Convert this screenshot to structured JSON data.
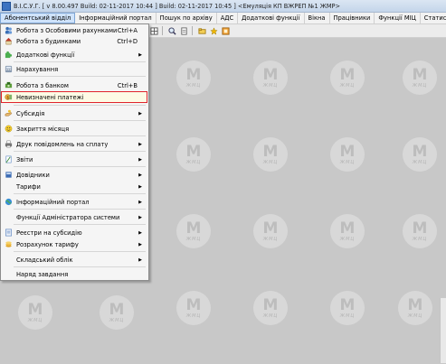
{
  "title_bar": {
    "text": "В.І.С.У.Г. [ v 8.00.497 Build: 02-11-2017 10:44 ]   Build: 02-11-2017 10:45 ] <Емуляція КП ВЖРЕП №1 ЖМР>"
  },
  "menubar": {
    "items": [
      {
        "label": "Абонентський відділ",
        "active": true
      },
      {
        "label": "Інформаційний портал"
      },
      {
        "label": "Пошук по архіву"
      },
      {
        "label": "АДС"
      },
      {
        "label": "Додаткові функції"
      },
      {
        "label": "Вікна"
      },
      {
        "label": "Працівники"
      },
      {
        "label": "Функції МІЦ"
      },
      {
        "label": "Статистика"
      }
    ]
  },
  "toolbar": {
    "icons": [
      "grid-icon",
      "magnifier-icon",
      "document-icon",
      "folder-icon",
      "star-icon",
      "palette-icon"
    ]
  },
  "dropdown": {
    "items": [
      {
        "label": "Робота з Особовими рахунками",
        "shortcut": "Ctrl+A",
        "icon": "people-icon"
      },
      {
        "label": "Робота з будинками",
        "shortcut": "Ctrl+D",
        "icon": "house-icon"
      },
      {
        "label": "Додаткові функції",
        "submenu": true,
        "icon": "puzzle-icon"
      },
      {
        "label": "Нарахування",
        "icon": "calculator-icon"
      },
      {
        "label": "Робота з банком",
        "shortcut": "Ctrl+B",
        "icon": "bank-icon"
      },
      {
        "label": "Невизначені платежі",
        "icon": "money-icon",
        "highlighted": true
      },
      {
        "label": "Субсидія",
        "submenu": true,
        "icon": "hand-icon"
      },
      {
        "label": "Закриття місяця",
        "icon": "smiley-icon"
      },
      {
        "label": "Друк повідомлень на сплату",
        "submenu": true,
        "icon": "printer-icon"
      },
      {
        "label": "Звіти",
        "submenu": true,
        "icon": "report-icon"
      },
      {
        "label": "Довідники",
        "submenu": true,
        "icon": "book-icon"
      },
      {
        "label": "Тарифи",
        "submenu": true,
        "icon": "none"
      },
      {
        "label": "Інформаційний портал",
        "submenu": true,
        "icon": "globe-icon"
      },
      {
        "label": "Функції Адміністратора системи",
        "submenu": true,
        "icon": "none"
      },
      {
        "label": "Реєстри на субсидію",
        "submenu": true,
        "icon": "registry-icon"
      },
      {
        "label": "Розрахунок тарифу",
        "submenu": true,
        "icon": "coins-icon"
      },
      {
        "label": "Складський облік",
        "submenu": true,
        "icon": "none"
      },
      {
        "label": "Наряд завдання",
        "icon": "none"
      }
    ]
  },
  "watermark": {
    "letters": "М",
    "caption": "ЖМЦ"
  }
}
